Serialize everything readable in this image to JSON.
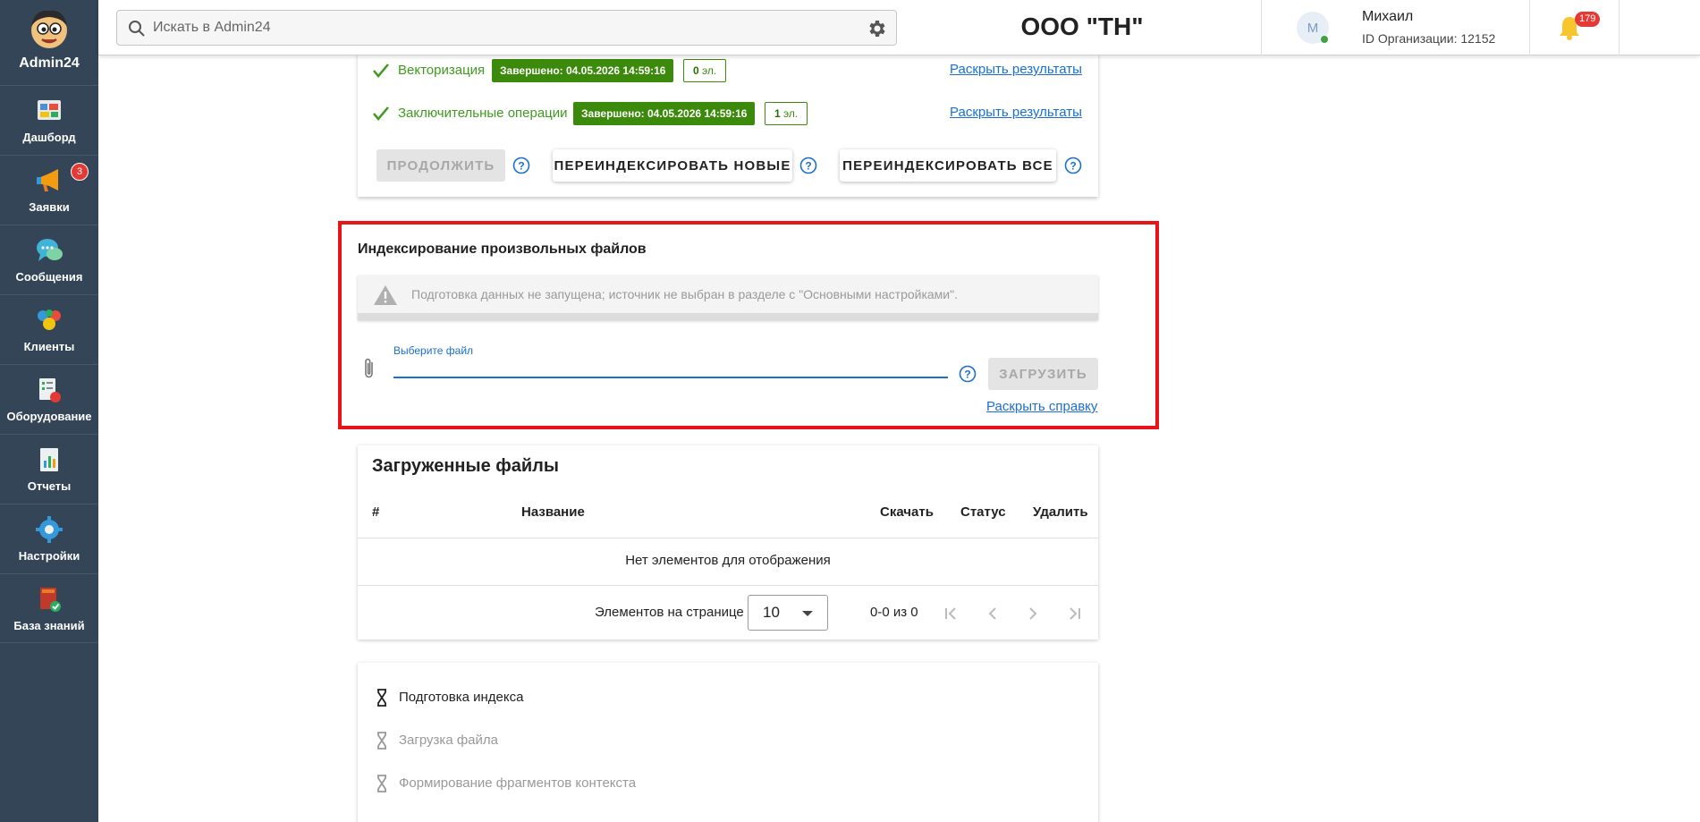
{
  "app": {
    "logo_text": "Admin24",
    "brand_colors": {
      "sidebar_bg": "#334556",
      "accent_blue": "#1a6fd0",
      "success_green": "#3c8a0b",
      "highlight_red": "#e8141a"
    }
  },
  "sidebar": {
    "items": [
      {
        "label": "Дашборд",
        "icon": "dashboard-icon"
      },
      {
        "label": "Заявки",
        "icon": "megaphone-icon",
        "badge": "3"
      },
      {
        "label": "Сообщения",
        "icon": "chat-icon"
      },
      {
        "label": "Клиенты",
        "icon": "clients-icon"
      },
      {
        "label": "Оборудование",
        "icon": "equipment-icon"
      },
      {
        "label": "Отчеты",
        "icon": "reports-icon"
      },
      {
        "label": "Настройки",
        "icon": "gear-icon"
      },
      {
        "label": "База знаний",
        "icon": "book-icon"
      }
    ]
  },
  "header": {
    "search_placeholder": "Искать в Admin24",
    "org_title": "ООО \"ТН\"",
    "user": {
      "initial": "М",
      "name": "Михаил",
      "org_id": "ID Организации: 12152"
    },
    "notifications_count": "179"
  },
  "indexing_card": {
    "stages": [
      {
        "name": "Векторизация",
        "status": "Завершено: 04.05.2026 14:59:16",
        "count_num": "0",
        "count_unit": "эл.",
        "link": "Раскрыть результаты"
      },
      {
        "name": "Заключительные операции",
        "status": "Завершено: 04.05.2026 14:59:16",
        "count_num": "1",
        "count_unit": "эл.",
        "link": "Раскрыть результаты"
      }
    ],
    "buttons": {
      "continue": "ПРОДОЛЖИТЬ",
      "reindex_new": "ПЕРЕИНДЕКСИРОВАТЬ НОВЫЕ",
      "reindex_all": "ПЕРЕИНДЕКСИРОВАТЬ ВСЕ"
    }
  },
  "custom_files": {
    "title": "Индексирование произвольных файлов",
    "warning": "Подготовка данных не запущена; источник не выбран в разделе с \"Основными настройками\".",
    "file_label": "Выберите файл",
    "upload_button": "ЗАГРУЗИТЬ",
    "help_link": "Раскрыть справку"
  },
  "uploaded_files": {
    "title": "Загруженные файлы",
    "columns": [
      "#",
      "Название",
      "Скачать",
      "Статус",
      "Удалить"
    ],
    "empty_text": "Нет элементов для отображения",
    "per_page_label": "Элементов на странице",
    "per_page_value": "10",
    "range": "0-0 из 0"
  },
  "progress_steps": [
    {
      "label": "Подготовка индекса",
      "active": true
    },
    {
      "label": "Загрузка файла",
      "active": false
    },
    {
      "label": "Формирование фрагментов контекста",
      "active": false
    }
  ]
}
